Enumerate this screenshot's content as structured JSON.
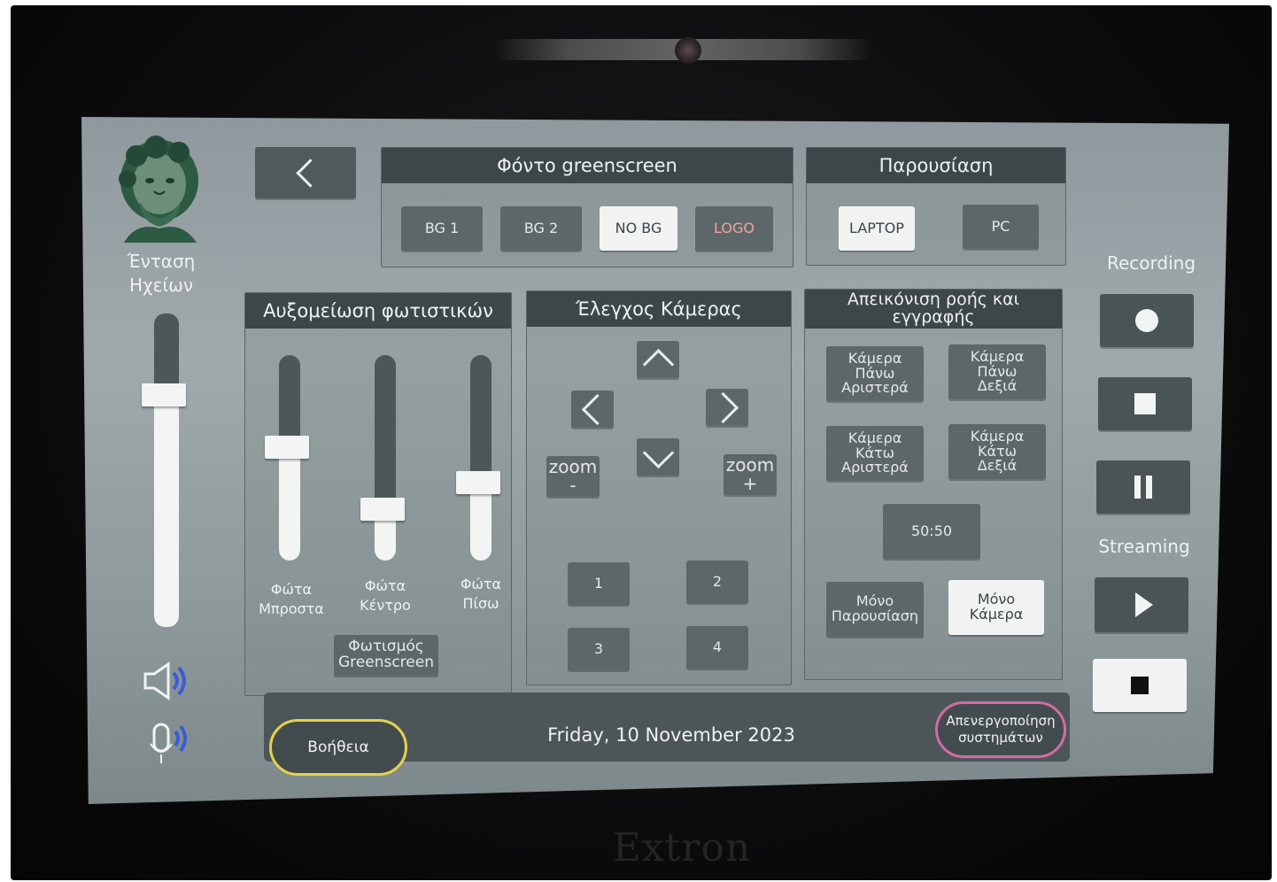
{
  "device": {
    "brand": "Extron"
  },
  "left_column": {
    "volume_label": "Ένταση\nΗχείων",
    "volume_level": 0.74,
    "speaker_icon": "speaker-icon",
    "mic_icon": "microphone-icon"
  },
  "nav": {
    "back_icon": "chevron-left-icon"
  },
  "greenscreen_bg": {
    "title": "Φόντο greenscreen",
    "buttons": [
      "BG 1",
      "BG 2",
      "NO BG",
      "LOGO"
    ],
    "selected": "NO BG"
  },
  "presentation": {
    "title": "Παρουσίαση",
    "buttons": [
      "LAPTOP",
      "PC"
    ],
    "selected": "LAPTOP"
  },
  "lights": {
    "title": "Αυξομείωση φωτιστικών",
    "sliders": [
      {
        "label": "Φώτα\nΜπροστα",
        "level": 0.55
      },
      {
        "label": "Φώτα\nΚέντρο",
        "level": 0.25
      },
      {
        "label": "Φώτα\nΠίσω",
        "level": 0.38
      }
    ],
    "greenscreen_button": "Φωτισμός\nGreenscreen"
  },
  "camera_control": {
    "title": "Έλεγχος Κάμερας",
    "zoom_out": "zoom\n-",
    "zoom_in": "zoom\n+",
    "presets": [
      "1",
      "2",
      "3",
      "4"
    ]
  },
  "stream_view": {
    "title": "Απεικόνιση ροής και\nεγγραφής",
    "cameras": [
      "Κάμερα\nΠάνω\nΑριστερά",
      "Κάμερα\nΠάνω\nΔεξιά",
      "Κάμερα\nΚάτω\nΑριστερά",
      "Κάμερα\nΚάτω\nΔεξιά"
    ],
    "split": "50:50",
    "only_presentation": "Μόνο\nΠαρουσίαση",
    "only_camera": "Μόνο\nΚάμερα",
    "selected": "Μόνο\nΚάμερα"
  },
  "recording": {
    "title": "Recording",
    "icons": [
      "record-icon",
      "stop-icon",
      "pause-icon"
    ]
  },
  "streaming": {
    "title": "Streaming",
    "icons": [
      "play-icon",
      "stop-icon"
    ]
  },
  "footer": {
    "help": "Βοήθεια",
    "date": "Friday, 10 November 2023",
    "shutdown": "Απενεργοποίηση\nσυστημάτων"
  },
  "colors": {
    "help_outline": "#e6d24a",
    "shutdown_outline": "#d56aa6",
    "logo_text": "#f0a39c"
  }
}
